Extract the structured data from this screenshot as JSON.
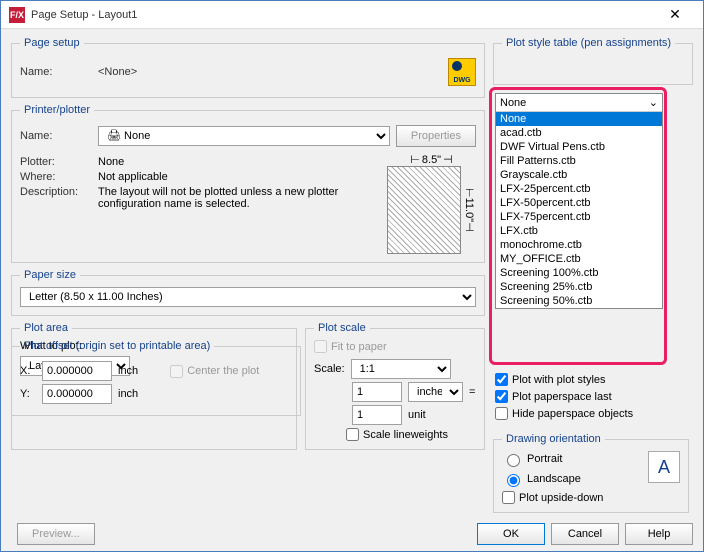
{
  "window": {
    "title": "Page Setup - Layout1"
  },
  "pageSetup": {
    "legend": "Page setup",
    "nameLabel": "Name:",
    "nameValue": "<None>"
  },
  "printer": {
    "legend": "Printer/plotter",
    "nameLabel": "Name:",
    "nameValue": "None",
    "propertiesBtn": "Properties",
    "plotterLabel": "Plotter:",
    "plotterValue": "None",
    "whereLabel": "Where:",
    "whereValue": "Not applicable",
    "descLabel": "Description:",
    "descValue": "The layout will not be plotted unless a new plotter configuration name is selected.",
    "previewW": "8.5\"",
    "previewH": "11.0\""
  },
  "paperSize": {
    "legend": "Paper size",
    "value": "Letter (8.50 x 11.00 Inches)"
  },
  "plotArea": {
    "legend": "Plot area",
    "whatLabel": "What to plot:",
    "value": "Layout"
  },
  "plotScale": {
    "legend": "Plot scale",
    "fitLabel": "Fit to paper",
    "scaleLabel": "Scale:",
    "scaleValue": "1:1",
    "num1": "1",
    "unit1": "inches",
    "eq": "=",
    "num2": "1",
    "unit2": "unit",
    "scaleLW": "Scale lineweights"
  },
  "plotOffset": {
    "legend": "Plot offset (origin set to printable area)",
    "xLabel": "X:",
    "xVal": "0.000000",
    "yLabel": "Y:",
    "yVal": "0.000000",
    "inch": "inch",
    "centerLabel": "Center the plot"
  },
  "plotStyle": {
    "legend": "Plot style table (pen assignments)",
    "selected": "None",
    "options": [
      "None",
      "acad.ctb",
      "DWF Virtual Pens.ctb",
      "Fill Patterns.ctb",
      "Grayscale.ctb",
      "LFX-25percent.ctb",
      "LFX-50percent.ctb",
      "LFX-75percent.ctb",
      "LFX.ctb",
      "monochrome.ctb",
      "MY_OFFICE.ctb",
      "Screening 100%.ctb",
      "Screening 25%.ctb",
      "Screening 50%.ctb"
    ]
  },
  "plotOptions": {
    "withStyles": "Plot with plot styles",
    "paperspace": "Plot paperspace last",
    "hide": "Hide paperspace objects"
  },
  "orientation": {
    "legend": "Drawing orientation",
    "portrait": "Portrait",
    "landscape": "Landscape",
    "upside": "Plot upside-down"
  },
  "footer": {
    "preview": "Preview...",
    "ok": "OK",
    "cancel": "Cancel",
    "help": "Help"
  }
}
